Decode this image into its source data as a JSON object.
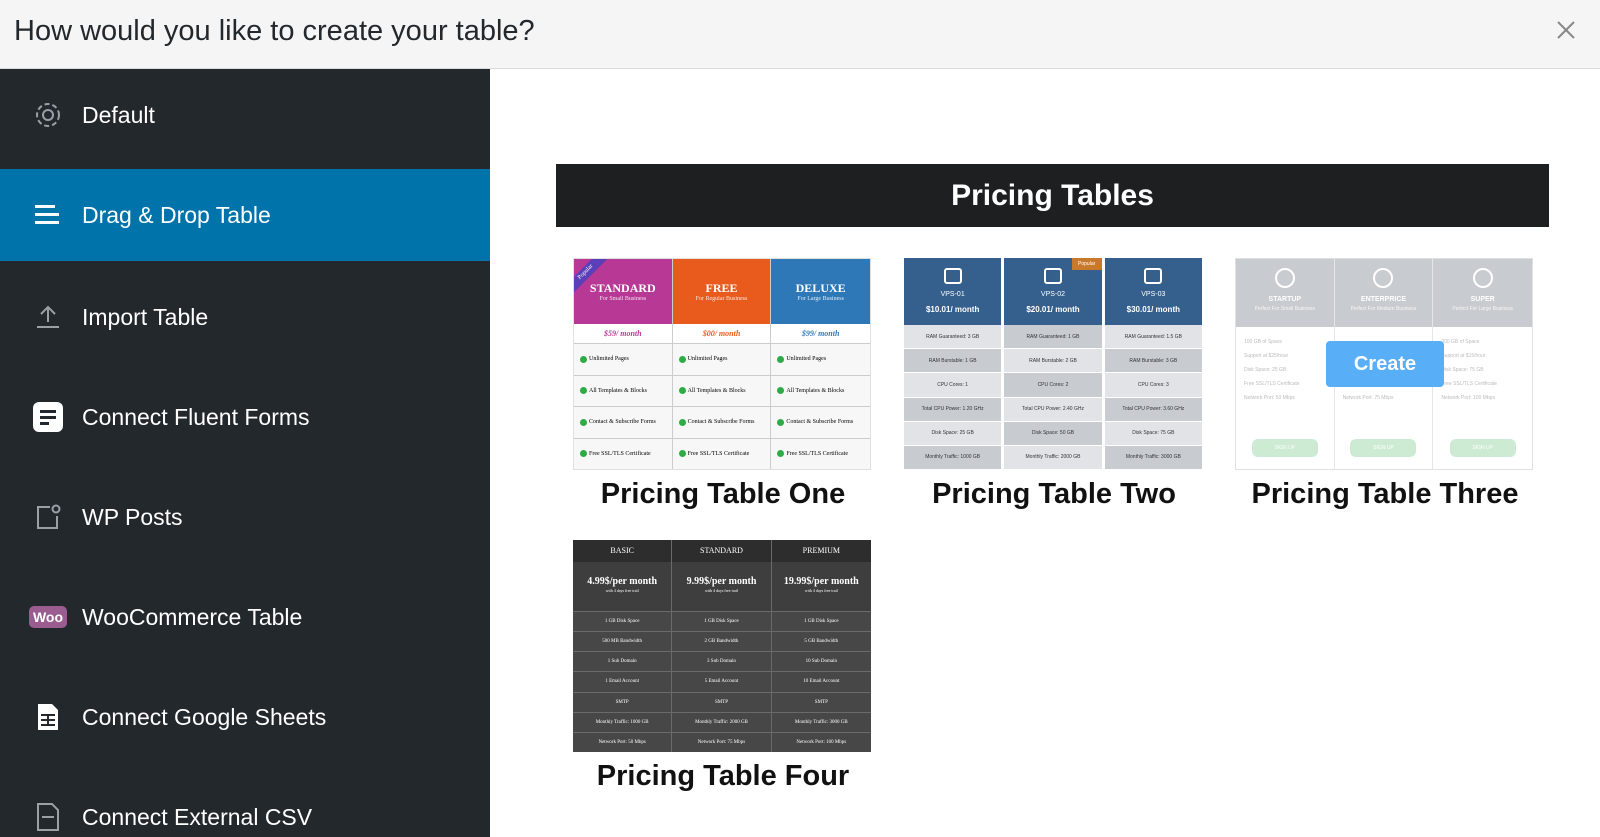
{
  "header": {
    "title": "How would you like to create your table?"
  },
  "sidebar": {
    "items": [
      {
        "label": "Default",
        "icon": "gear-icon"
      },
      {
        "label": "Drag & Drop Table",
        "icon": "drag-drop-icon"
      },
      {
        "label": "Import Table",
        "icon": "upload-icon"
      },
      {
        "label": "Connect Fluent Forms",
        "icon": "fluent-forms-icon"
      },
      {
        "label": "WP Posts",
        "icon": "post-icon"
      },
      {
        "label": "WooCommerce Table",
        "icon": "woo-icon"
      },
      {
        "label": "Connect Google Sheets",
        "icon": "sheet-icon"
      },
      {
        "label": "Connect External CSV",
        "icon": "csv-icon"
      }
    ],
    "woo_text": "Woo"
  },
  "main": {
    "section_title": "Pricing Tables",
    "create_label": "Create",
    "templates": [
      {
        "label": "Pricing Table One"
      },
      {
        "label": "Pricing Table Two"
      },
      {
        "label": "Pricing Table Three"
      },
      {
        "label": "Pricing Table Four"
      }
    ]
  },
  "t1": {
    "ribbon": "Popular",
    "cols": [
      {
        "name": "STANDARD",
        "sub": "For Small Business",
        "price": "$59/ month",
        "color": "#b83895",
        "price_color": "#b83895"
      },
      {
        "name": "FREE",
        "sub": "For Regular Business",
        "price": "$00/ month",
        "color": "#e85b1c",
        "price_color": "#e85b1c"
      },
      {
        "name": "DELUXE",
        "sub": "For Large Business",
        "price": "$99/ month",
        "color": "#2f78b7",
        "price_color": "#2f78b7"
      }
    ],
    "features": [
      "Unlimited Pages",
      "All Templates & Blocks",
      "Contact & Subscribe Forms",
      "Free SSL/TLS Certificate"
    ]
  },
  "t2": {
    "popular": "Popular",
    "cols": [
      {
        "name": "VPS-01",
        "price": "$10.01/ month",
        "rows": [
          "RAM Guaranteed: 3 GB",
          "RAM Burstable: 1 GB",
          "CPU Cores: 1",
          "Total CPU Power: 1.20 GHz",
          "Disk Space: 25 GB",
          "Monthly Traffic: 1000 GB"
        ]
      },
      {
        "name": "VPS-02",
        "price": "$20.01/ month",
        "rows": [
          "RAM Guaranteed: 1 GB",
          "RAM Burstable: 2 GB",
          "CPU Cores: 2",
          "Total CPU Power: 2.40 GHz",
          "Disk Space: 50 GB",
          "Monthly Traffic: 2000 GB"
        ]
      },
      {
        "name": "VPS-03",
        "price": "$30.01/ month",
        "rows": [
          "RAM Guaranteed: 1.5 GB",
          "RAM Burstable: 3 GB",
          "CPU Cores: 3",
          "Total CPU Power: 3.60 GHz",
          "Disk Space: 75 GB",
          "Monthly Traffic: 3000 GB"
        ]
      }
    ]
  },
  "t3": {
    "cols": [
      {
        "name": "STARTUP",
        "sub": "Perfect For Small Business",
        "rows": [
          "100 GB of Space",
          "Support at $25/hour",
          "Disk Space: 25 GB",
          "Free SSL/TLS Certificate",
          "Network Port: 50 Mbps"
        ],
        "btn": "SIGN UP"
      },
      {
        "name": "ENTERPRICE",
        "sub": "Perfect For Medium Business",
        "rows": [
          "",
          "",
          "",
          "Free SSL/TLS Certificate",
          "Network Port: 75 Mbps"
        ],
        "btn": "SIGN UP"
      },
      {
        "name": "SUPER",
        "sub": "Perfect For Large Business",
        "rows": [
          "300 GB of Space",
          "Support at $15/hour",
          "Disk Space: 75 GB",
          "Free SSL/TLS Certificate",
          "Network Port: 100 Mbps"
        ],
        "btn": "SIGN UP"
      }
    ]
  },
  "t4": {
    "cols": [
      {
        "name": "BASIC",
        "price": "4.99$/per month",
        "trial": "with 4 days free trail",
        "rows": [
          "1 GB Disk Space",
          "500 MB Bandwidth",
          "1 Sub Domain",
          "1 Email Account",
          "SMTP",
          "Monthly Traffic: 1000 GB",
          "Network Port: 50 Mbps"
        ]
      },
      {
        "name": "STANDARD",
        "price": "9.99$/per month",
        "trial": "with 4 days free trail",
        "rows": [
          "1 GB Disk Space",
          "2 GB Bandwidth",
          "3 Sub Domain",
          "5 Email Account",
          "SMTP",
          "Monthly Traffic: 2000 GB",
          "Network Port: 75 Mbps"
        ]
      },
      {
        "name": "PREMIUM",
        "price": "19.99$/per month",
        "trial": "with 4 days free trail",
        "rows": [
          "1 GB Disk Space",
          "5 GB Bandwidth",
          "10 Sub Domain",
          "10 Email Account",
          "SMTP",
          "Monthly Traffic: 3000 GB",
          "Network Port: 100 Mbps"
        ]
      }
    ]
  }
}
